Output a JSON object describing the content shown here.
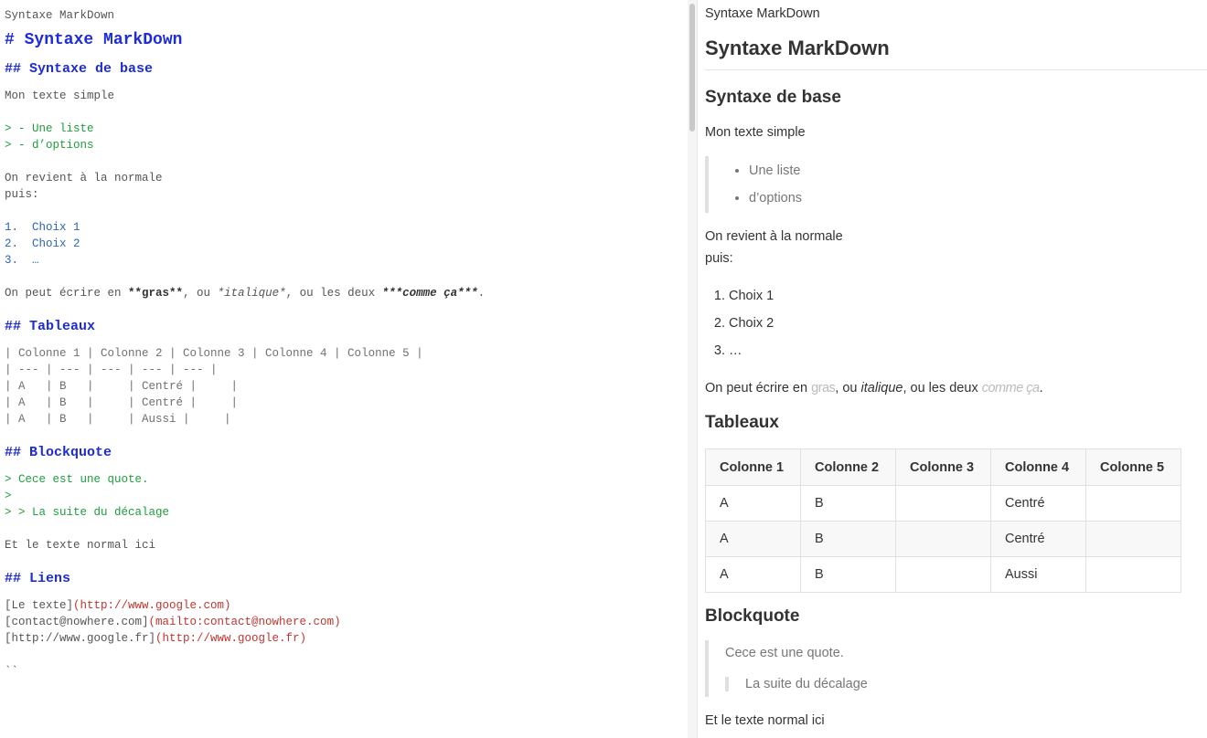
{
  "editor": {
    "doc_title": "Syntaxe MarkDown",
    "h1": "# Syntaxe MarkDown",
    "h2_base": "## Syntaxe de base",
    "simple_text": "Mon texte simple",
    "quote_list_1": "> - Une liste",
    "quote_list_2": "> - d’options",
    "back_normal": "On revient à la normale",
    "puis": "puis:",
    "ol_1": "1.  Choix 1",
    "ol_2": "2.  Choix 2",
    "ol_3": "3.  …",
    "emph_prefix": "On peut écrire en ",
    "emph_bold": "**gras**",
    "emph_mid1": ", ou ",
    "emph_ital": "*italique*",
    "emph_mid2": ", ou les deux ",
    "emph_both": "***comme ça***",
    "emph_end": ".",
    "h2_tables": "## Tableaux",
    "table_lines": [
      "| Colonne 1 | Colonne 2 | Colonne 3 | Colonne 4 | Colonne 5 |",
      "| --- | --- | --- | --- | --- |",
      "| A   | B   |     | Centré |     |",
      "| A   | B   |     | Centré |     |",
      "| A   | B   |     | Aussi |     |"
    ],
    "h2_blockquote": "## Blockquote",
    "bq_1": "> Cece est une quote.",
    "bq_2": ">",
    "bq_3": "> > La suite du décalage",
    "normal_here": "Et le texte normal ici",
    "h2_links": "## Liens",
    "links": [
      {
        "text": "[Le texte]",
        "url": "(http://www.google.com)"
      },
      {
        "text": "[contact@nowhere.com]",
        "url": "(mailto:contact@nowhere.com)"
      },
      {
        "text": "[http://www.google.fr]",
        "url": "(http://www.google.fr)"
      }
    ],
    "last_partial": "``"
  },
  "preview": {
    "doc_title": "Syntaxe MarkDown",
    "h1": "Syntaxe MarkDown",
    "h2_base": "Syntaxe de base",
    "simple_text": "Mon texte simple",
    "quote_list": [
      "Une liste",
      "d’options"
    ],
    "back_normal": "On revient à la normale",
    "puis": "puis:",
    "ordered": [
      "Choix 1",
      "Choix 2",
      "…"
    ],
    "emph_prefix": "On peut écrire en ",
    "emph_bold": "gras",
    "emph_mid1": ", ou ",
    "emph_ital": "italique",
    "emph_mid2": ", ou les deux ",
    "emph_both": "comme ça",
    "emph_end": ".",
    "h2_tables": "Tableaux",
    "table": {
      "headers": [
        "Colonne 1",
        "Colonne 2",
        "Colonne 3",
        "Colonne 4",
        "Colonne 5"
      ],
      "rows": [
        [
          "A",
          "B",
          "",
          "Centré",
          ""
        ],
        [
          "A",
          "B",
          "",
          "Centré",
          ""
        ],
        [
          "A",
          "B",
          "",
          "Aussi",
          ""
        ]
      ]
    },
    "h2_blockquote": "Blockquote",
    "bq_1": "Cece est une quote.",
    "bq_2": "La suite du décalage",
    "normal_here": "Et le texte normal ici"
  }
}
